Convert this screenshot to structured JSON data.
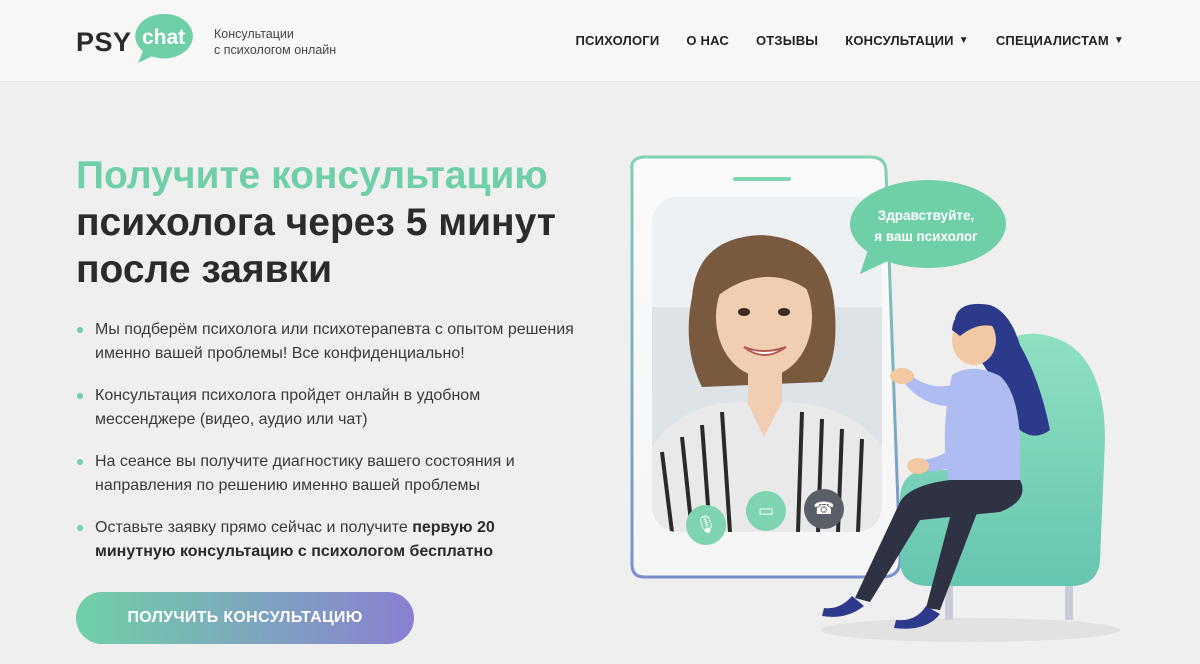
{
  "header": {
    "logo_psy": "PSY",
    "logo_chat": "chat",
    "tagline_line1": "Консультации",
    "tagline_line2": "с психологом онлайн",
    "nav": [
      {
        "label": "ПСИХОЛОГИ",
        "dropdown": false
      },
      {
        "label": "О НАС",
        "dropdown": false
      },
      {
        "label": "ОТЗЫВЫ",
        "dropdown": false
      },
      {
        "label": "КОНСУЛЬТАЦИИ",
        "dropdown": true
      },
      {
        "label": "СПЕЦИАЛИСТАМ",
        "dropdown": true
      }
    ]
  },
  "hero": {
    "title_accent": "Получите консультацию",
    "title_line2": "психолога через 5 минут",
    "title_line3": "после заявки",
    "bullets": [
      {
        "text": "Мы подберём психолога или психотерапевта с опытом решения именно вашей проблемы! Все конфиденциально!"
      },
      {
        "text": "Консультация психолога пройдет онлайн в удобном мессенджере (видео, аудио или чат)"
      },
      {
        "text": "На сеансе вы получите диагностику вашего состояния и направления по решению именно вашей проблемы"
      },
      {
        "text": "Оставьте заявку прямо сейчас и получите ",
        "bold": "первую 20 минутную консультацию с психологом бесплатно"
      }
    ],
    "cta_label": "ПОЛУЧИТЬ КОНСУЛЬТАЦИЮ"
  },
  "illustration": {
    "speech_line1": "Здравствуйте,",
    "speech_line2": "я ваш психолог",
    "icons": [
      "microphone-icon",
      "video-icon",
      "hang-up-icon"
    ]
  },
  "colors": {
    "accent_green": "#6fd0a7",
    "accent_purple": "#8a7fd1",
    "text_dark": "#2b2b2b",
    "background": "#efefef"
  }
}
